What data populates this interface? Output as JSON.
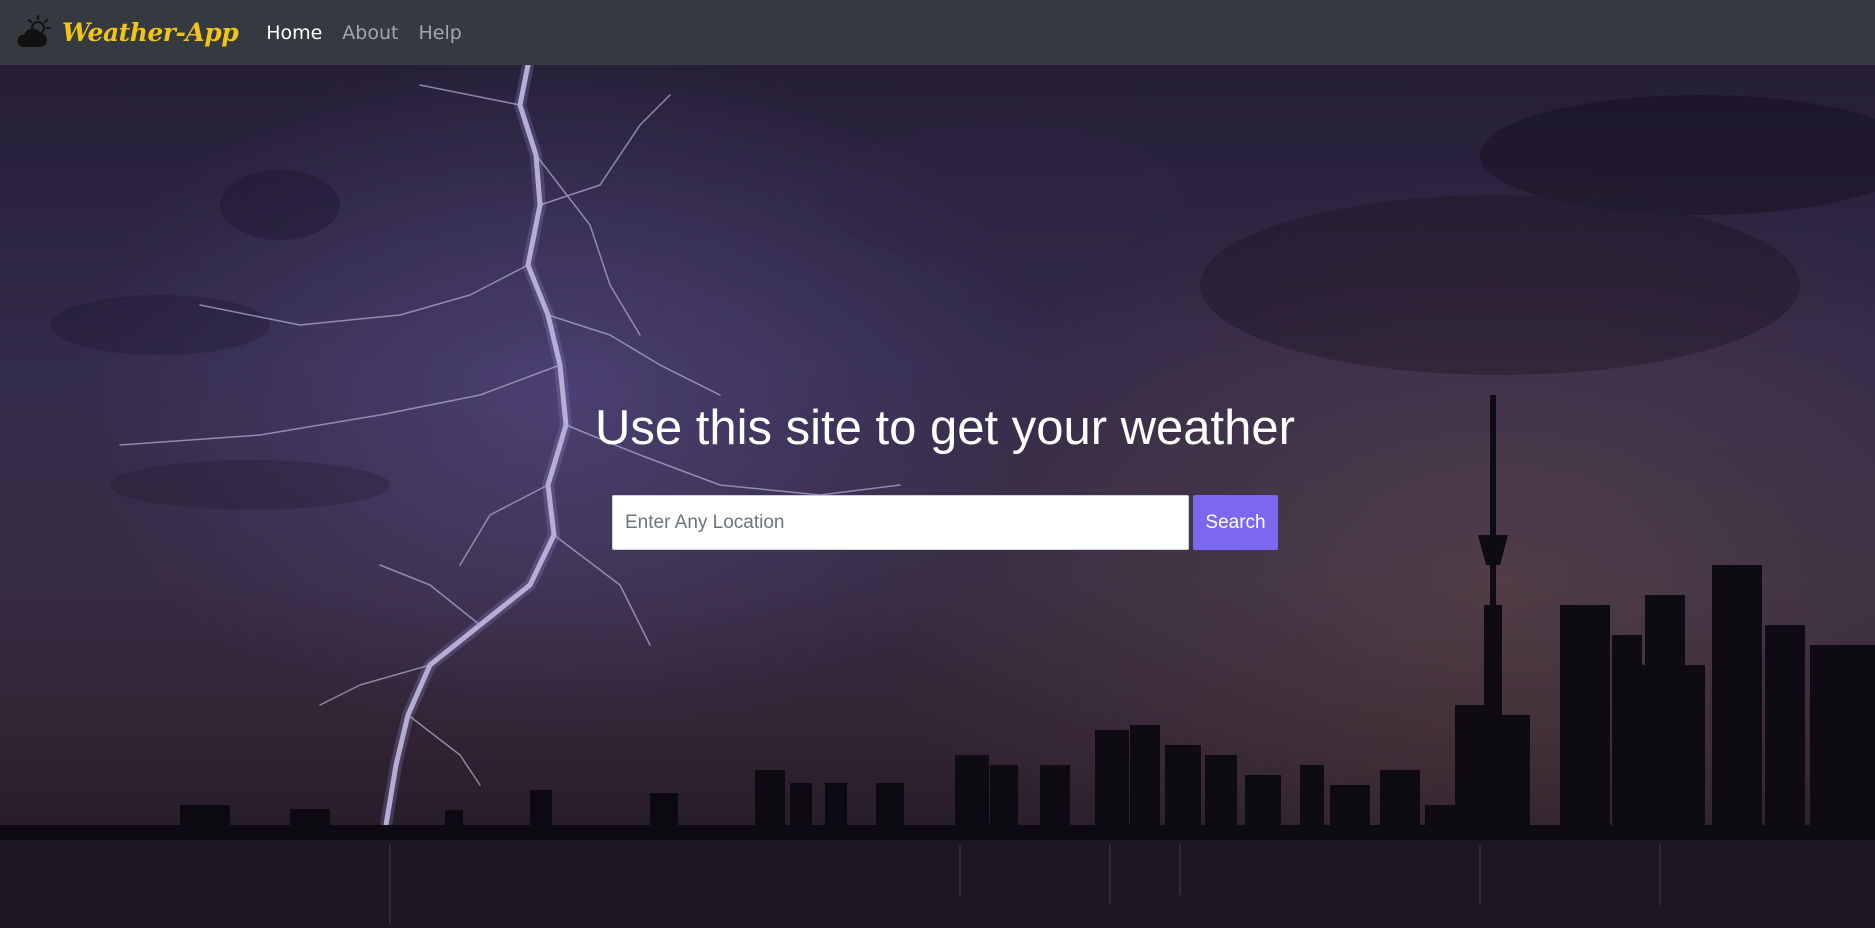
{
  "navbar": {
    "brand": "Weather-App",
    "brand_icon": "cloud-sun-icon",
    "links": [
      {
        "label": "Home",
        "active": true
      },
      {
        "label": "About",
        "active": false
      },
      {
        "label": "Help",
        "active": false
      }
    ]
  },
  "hero": {
    "headline": "Use this site to get your weather",
    "background": "stormy-city-skyline-with-lightning"
  },
  "search": {
    "placeholder": "Enter Any Location",
    "value": "",
    "button_label": "Search"
  },
  "colors": {
    "navbar_bg": "#343a40",
    "brand": "#f0c419",
    "button_bg": "#7b68ee"
  }
}
